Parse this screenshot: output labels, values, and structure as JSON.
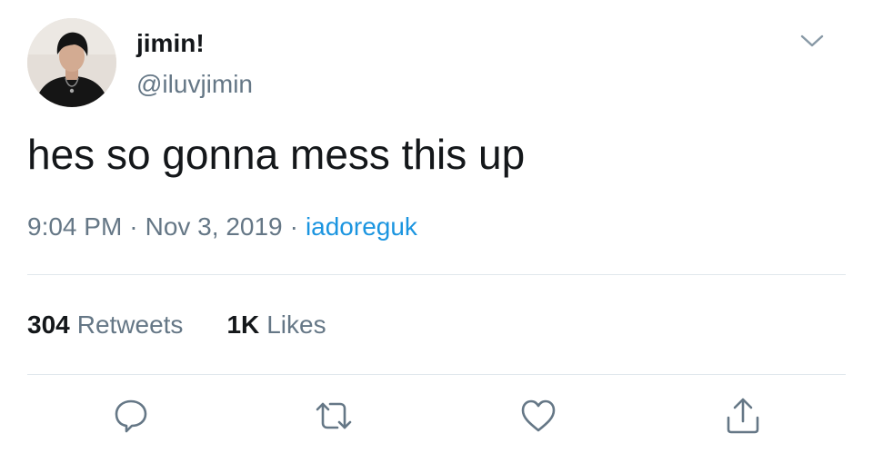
{
  "user": {
    "display_name": "jimin!",
    "handle": "@iluvjimin"
  },
  "tweet": {
    "text": "hes so gonna mess this up",
    "time": "9:04 PM",
    "separator": "·",
    "date": "Nov 3, 2019",
    "source": "iadoreguk"
  },
  "stats": {
    "retweets_count": "304",
    "retweets_label": "Retweets",
    "likes_count": "1K",
    "likes_label": "Likes"
  },
  "icons": {
    "menu": "chevron-down-icon",
    "reply": "reply-icon",
    "retweet": "retweet-icon",
    "like": "heart-icon",
    "share": "share-icon"
  },
  "colors": {
    "text": "#14171a",
    "secondary": "#657786",
    "link": "#1b95e0",
    "divider": "#e1e8ed"
  }
}
